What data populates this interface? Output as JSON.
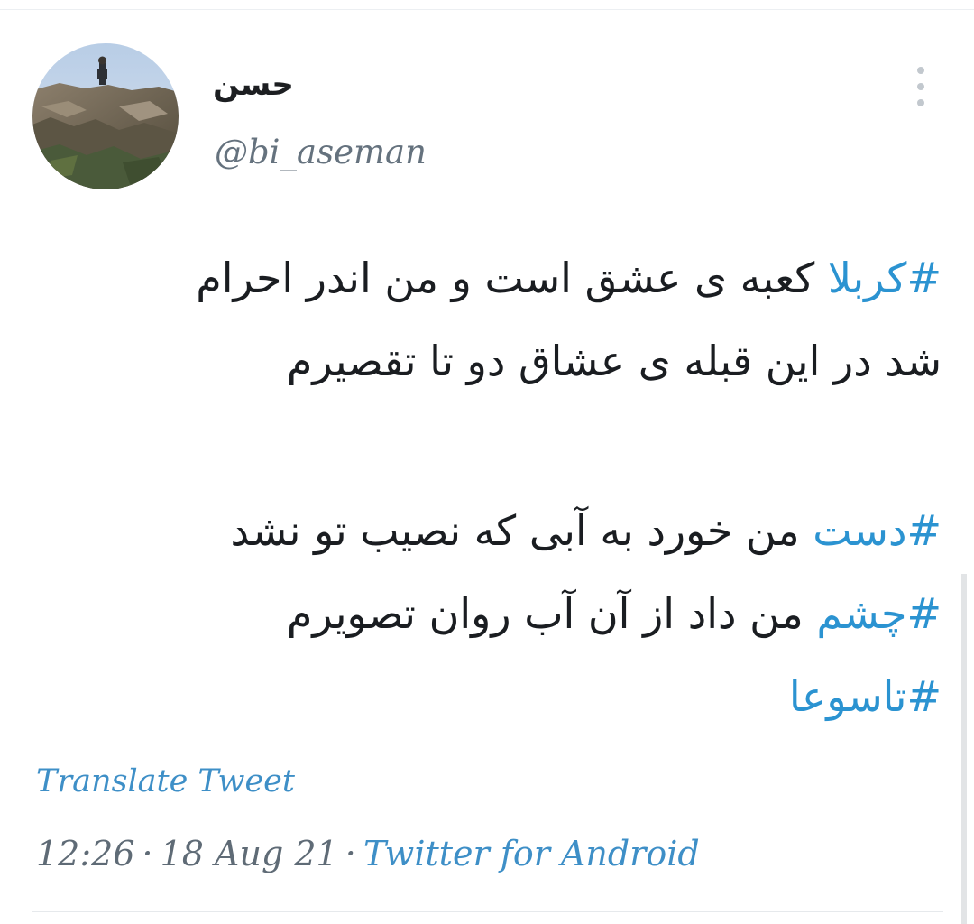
{
  "tweet": {
    "author": {
      "display_name": "حسن",
      "handle": "@bi_aseman"
    },
    "lines": [
      {
        "hashtag": "#کربلا",
        "text": " کعبه ی عشق است و من اندر احرام"
      },
      {
        "hashtag": "",
        "text": "شد در این قبله ی عشاق دو تا تقصیرم"
      },
      {
        "hashtag": "",
        "text": ""
      },
      {
        "hashtag": "#دست",
        "text": " من خورد به آبی که نصیب تو نشد"
      },
      {
        "hashtag": "#چشم",
        "text": " من داد از آن آب روان تصویرم"
      },
      {
        "hashtag": "#تاسوعا",
        "text": ""
      }
    ],
    "translate_label": "Translate Tweet",
    "time": "12:26",
    "separator": "·",
    "date": "18 Aug 21",
    "source": "Twitter for Android"
  },
  "icons": {
    "more_menu": "more-vertical-icon"
  },
  "colors": {
    "link": "#2b93d1",
    "secondary_text": "#5f6b76",
    "primary_text": "#1a1d21"
  }
}
